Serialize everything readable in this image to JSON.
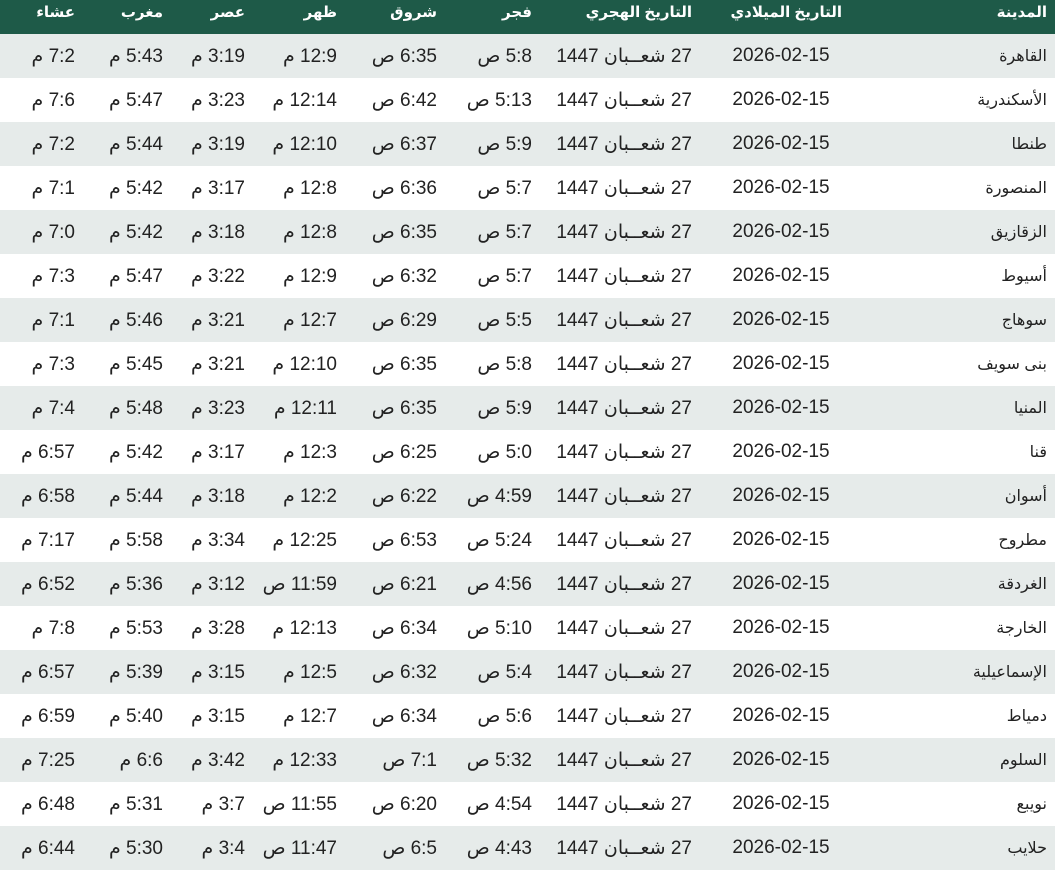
{
  "headers": {
    "city": "المدينة",
    "gregorian": "التاريخ الميلادي",
    "hijri": "التاريخ الهجري",
    "fajr": "فجر",
    "shurooq": "شروق",
    "dhuhr": "ظهر",
    "asr": "عصر",
    "maghrib": "مغرب",
    "isha": "عشاء"
  },
  "rows": [
    {
      "city": "القاهرة",
      "gregorian": "2026-02-15",
      "hijri": "27 شعــبان 1447",
      "fajr": "5:8 ص",
      "shurooq": "6:35 ص",
      "dhuhr": "12:9 م",
      "asr": "3:19 م",
      "maghrib": "5:43 م",
      "isha": "7:2 م"
    },
    {
      "city": "الأسكندرية",
      "gregorian": "2026-02-15",
      "hijri": "27 شعــبان 1447",
      "fajr": "5:13 ص",
      "shurooq": "6:42 ص",
      "dhuhr": "12:14 م",
      "asr": "3:23 م",
      "maghrib": "5:47 م",
      "isha": "7:6 م"
    },
    {
      "city": "طنطا",
      "gregorian": "2026-02-15",
      "hijri": "27 شعــبان 1447",
      "fajr": "5:9 ص",
      "shurooq": "6:37 ص",
      "dhuhr": "12:10 م",
      "asr": "3:19 م",
      "maghrib": "5:44 م",
      "isha": "7:2 م"
    },
    {
      "city": "المنصورة",
      "gregorian": "2026-02-15",
      "hijri": "27 شعــبان 1447",
      "fajr": "5:7 ص",
      "shurooq": "6:36 ص",
      "dhuhr": "12:8 م",
      "asr": "3:17 م",
      "maghrib": "5:42 م",
      "isha": "7:1 م"
    },
    {
      "city": "الزقازيق",
      "gregorian": "2026-02-15",
      "hijri": "27 شعــبان 1447",
      "fajr": "5:7 ص",
      "shurooq": "6:35 ص",
      "dhuhr": "12:8 م",
      "asr": "3:18 م",
      "maghrib": "5:42 م",
      "isha": "7:0 م"
    },
    {
      "city": "أسيوط",
      "gregorian": "2026-02-15",
      "hijri": "27 شعــبان 1447",
      "fajr": "5:7 ص",
      "shurooq": "6:32 ص",
      "dhuhr": "12:9 م",
      "asr": "3:22 م",
      "maghrib": "5:47 م",
      "isha": "7:3 م"
    },
    {
      "city": "سوهاج",
      "gregorian": "2026-02-15",
      "hijri": "27 شعــبان 1447",
      "fajr": "5:5 ص",
      "shurooq": "6:29 ص",
      "dhuhr": "12:7 م",
      "asr": "3:21 م",
      "maghrib": "5:46 م",
      "isha": "7:1 م"
    },
    {
      "city": "بنى سويف",
      "gregorian": "2026-02-15",
      "hijri": "27 شعــبان 1447",
      "fajr": "5:8 ص",
      "shurooq": "6:35 ص",
      "dhuhr": "12:10 م",
      "asr": "3:21 م",
      "maghrib": "5:45 م",
      "isha": "7:3 م"
    },
    {
      "city": "المنيا",
      "gregorian": "2026-02-15",
      "hijri": "27 شعــبان 1447",
      "fajr": "5:9 ص",
      "shurooq": "6:35 ص",
      "dhuhr": "12:11 م",
      "asr": "3:23 م",
      "maghrib": "5:48 م",
      "isha": "7:4 م"
    },
    {
      "city": "قنا",
      "gregorian": "2026-02-15",
      "hijri": "27 شعــبان 1447",
      "fajr": "5:0 ص",
      "shurooq": "6:25 ص",
      "dhuhr": "12:3 م",
      "asr": "3:17 م",
      "maghrib": "5:42 م",
      "isha": "6:57 م"
    },
    {
      "city": "أسوان",
      "gregorian": "2026-02-15",
      "hijri": "27 شعــبان 1447",
      "fajr": "4:59 ص",
      "shurooq": "6:22 ص",
      "dhuhr": "12:2 م",
      "asr": "3:18 م",
      "maghrib": "5:44 م",
      "isha": "6:58 م"
    },
    {
      "city": "مطروح",
      "gregorian": "2026-02-15",
      "hijri": "27 شعــبان 1447",
      "fajr": "5:24 ص",
      "shurooq": "6:53 ص",
      "dhuhr": "12:25 م",
      "asr": "3:34 م",
      "maghrib": "5:58 م",
      "isha": "7:17 م"
    },
    {
      "city": "الغردقة",
      "gregorian": "2026-02-15",
      "hijri": "27 شعــبان 1447",
      "fajr": "4:56 ص",
      "shurooq": "6:21 ص",
      "dhuhr": "11:59 ص",
      "asr": "3:12 م",
      "maghrib": "5:36 م",
      "isha": "6:52 م"
    },
    {
      "city": "الخارجة",
      "gregorian": "2026-02-15",
      "hijri": "27 شعــبان 1447",
      "fajr": "5:10 ص",
      "shurooq": "6:34 ص",
      "dhuhr": "12:13 م",
      "asr": "3:28 م",
      "maghrib": "5:53 م",
      "isha": "7:8 م"
    },
    {
      "city": "الإسماعيلية",
      "gregorian": "2026-02-15",
      "hijri": "27 شعــبان 1447",
      "fajr": "5:4 ص",
      "shurooq": "6:32 ص",
      "dhuhr": "12:5 م",
      "asr": "3:15 م",
      "maghrib": "5:39 م",
      "isha": "6:57 م"
    },
    {
      "city": "دمياط",
      "gregorian": "2026-02-15",
      "hijri": "27 شعــبان 1447",
      "fajr": "5:6 ص",
      "shurooq": "6:34 ص",
      "dhuhr": "12:7 م",
      "asr": "3:15 م",
      "maghrib": "5:40 م",
      "isha": "6:59 م"
    },
    {
      "city": "السلوم",
      "gregorian": "2026-02-15",
      "hijri": "27 شعــبان 1447",
      "fajr": "5:32 ص",
      "shurooq": "7:1 ص",
      "dhuhr": "12:33 م",
      "asr": "3:42 م",
      "maghrib": "6:6 م",
      "isha": "7:25 م"
    },
    {
      "city": "نويبع",
      "gregorian": "2026-02-15",
      "hijri": "27 شعــبان 1447",
      "fajr": "4:54 ص",
      "shurooq": "6:20 ص",
      "dhuhr": "11:55 ص",
      "asr": "3:7 م",
      "maghrib": "5:31 م",
      "isha": "6:48 م"
    },
    {
      "city": "حلايب",
      "gregorian": "2026-02-15",
      "hijri": "27 شعــبان 1447",
      "fajr": "4:43 ص",
      "shurooq": "6:5 ص",
      "dhuhr": "11:47 ص",
      "asr": "3:4 م",
      "maghrib": "5:30 م",
      "isha": "6:44 م"
    }
  ],
  "colors": {
    "header_bg": "#1e5a48",
    "header_text": "#ffffff",
    "stripe": "#e6ebea",
    "row_bg": "#ffffff",
    "text": "#222222"
  }
}
